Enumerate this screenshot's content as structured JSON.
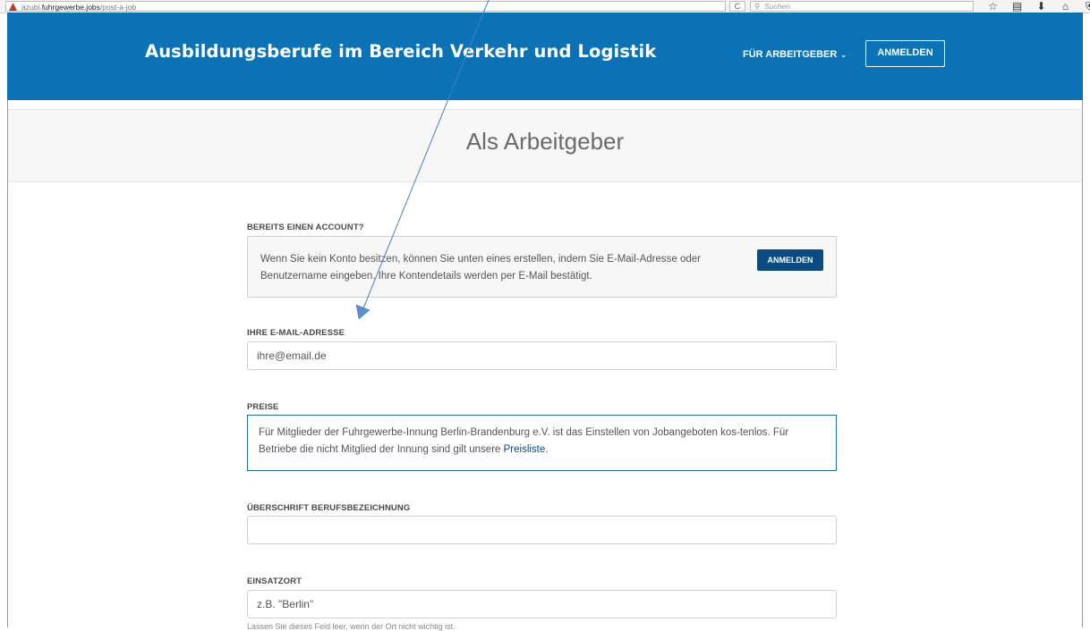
{
  "browser": {
    "url_prefix": "azubi.",
    "url_domain": "fuhrgewerbe.jobs",
    "url_path": "/post-a-job",
    "reload_glyph": "C",
    "search_placeholder": "Suchen",
    "icons": [
      "star-icon",
      "reading-list-icon",
      "download-icon",
      "home-icon",
      "shield-icon"
    ]
  },
  "header": {
    "title": "Ausbildungsberufe im Bereich Verkehr und Logistik",
    "nav_employer": "FÜR ARBEITGEBER",
    "nav_login": "ANMELDEN",
    "bg_color": "#0b72b5"
  },
  "page": {
    "title": "Als Arbeitgeber"
  },
  "account": {
    "label": "BEREITS EINEN ACCOUNT?",
    "text": "Wenn Sie kein Konto besitzen, können Sie unten eines erstellen, indem Sie E-Mail-Adresse oder Benutzername eingeben. Ihre Kontendetails werden per E-Mail bestätigt.",
    "button": "ANMELDEN"
  },
  "email": {
    "label": "IHRE E-MAIL-ADRESSE",
    "placeholder": "ihre@email.de"
  },
  "prices": {
    "label": "PREISE",
    "text": "Für Mitglieder der Fuhrgewerbe-Innung Berlin-Brandenburg e.V. ist das Einstellen von Jobangeboten kos-tenlos. Für Betriebe die nicht Mitglied der Innung sind gilt unsere",
    "link": "Preisliste",
    "after_link": "."
  },
  "job_title": {
    "label": "ÜBERSCHRIFT BERUFSBEZEICHNUNG",
    "value": ""
  },
  "location": {
    "label": "EINSATZORT",
    "placeholder": "z.B. \"Berlin\"",
    "hint": "Lassen Sie dieses Feld leer, wenn der Ort nicht wichtig ist."
  }
}
